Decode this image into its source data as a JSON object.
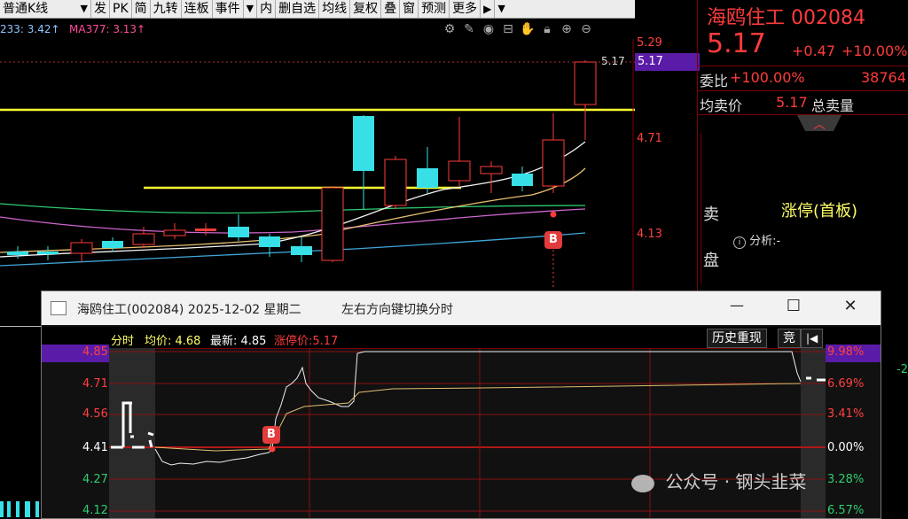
{
  "toolbar": {
    "items": [
      "普通K线",
      "▼",
      "发",
      "PK",
      "简",
      "九转",
      "连板",
      "事件",
      "▼",
      "内",
      "删自选",
      "均线",
      "复权",
      "叠",
      "窗",
      "预测",
      "更多"
    ],
    "play_icon": "▶",
    "dropdown_icon": "▼"
  },
  "ma_line": {
    "ma233": "233: 3.42↑",
    "ma377": "MA377: 3.13↑",
    "ma233_color": "#8ec5ff",
    "ma377_color": "#ff4d9a"
  },
  "toolbar_icons": [
    "gear-icon",
    "brush-icon",
    "eye-icon",
    "basket-icon",
    "hand-icon",
    "lock-icon",
    "zoom-in-icon",
    "zoom-out-icon"
  ],
  "price_scale": {
    "top": "5.29",
    "current_label": "5.17",
    "current_tag": "5.17",
    "mid": "4.71",
    "low": "4.13",
    "marker": "B"
  },
  "quote": {
    "name": "海鸥住工",
    "code": "002084",
    "price": "5.17",
    "change": "+0.47",
    "pct": "+10.00%",
    "webi_label": "委比",
    "webi_value": "+100.00%",
    "webi_num": "38764",
    "avg_sell_label": "均卖价",
    "avg_sell_value": "5.17",
    "total_sell_label": "总卖量",
    "side_label_1": "卖",
    "side_label_2": "盘",
    "status": "涨停(首板)",
    "analysis_label": "分析:-"
  },
  "popup": {
    "title": "海鸥住工(002084) 2025-12-02 星期二",
    "hint": "左右方向键切换分时",
    "bar_title": "分时",
    "avg_label": "均价: 4.68",
    "latest_label": "最新: 4.85",
    "limit_label": "涨停价:5.17",
    "btn_replay": "历史重现",
    "btn_jing": "竞",
    "btn_back": "|◀",
    "left_scale": [
      "4.85",
      "4.71",
      "4.56",
      "4.41",
      "4.27",
      "4.12"
    ],
    "right_scale": [
      "9.98%",
      "6.69%",
      "3.41%",
      "0.00%",
      "3.28%",
      "6.57%"
    ],
    "marker": "B",
    "edge_value": "-2"
  },
  "watermark": "公众号 · 钢头韭菜",
  "colors": {
    "up": "#ff3b3b",
    "down": "#37e0e6",
    "yellow": "#ffff33",
    "purple_tag": "#5a1ca8"
  }
}
